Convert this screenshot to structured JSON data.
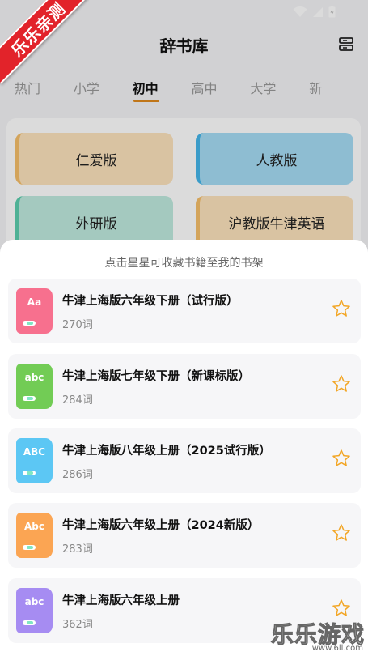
{
  "app": {
    "title": "辞书库"
  },
  "ribbon": {
    "text": "乐乐亲测"
  },
  "tabs": [
    {
      "label": "热门"
    },
    {
      "label": "小学"
    },
    {
      "label": "初中"
    },
    {
      "label": "高中"
    },
    {
      "label": "大学"
    },
    {
      "label": "新"
    }
  ],
  "active_tab": "初中",
  "editions": [
    {
      "label": "仁爱版"
    },
    {
      "label": "人教版"
    },
    {
      "label": "外研版"
    },
    {
      "label": "沪教版牛津英语"
    }
  ],
  "sheet": {
    "hint": "点击星星可收藏书籍至我的书架",
    "books": [
      {
        "cover_label": "Aa",
        "cover_color": "#f7708e",
        "title": "牛津上海版六年级下册（试行版）",
        "count": "270词"
      },
      {
        "cover_label": "abc",
        "cover_color": "#72cc55",
        "title": "牛津上海版七年级下册（新课标版）",
        "count": "284词"
      },
      {
        "cover_label": "ABC",
        "cover_color": "#5cc7f4",
        "title": "牛津上海版八年级上册（2025试行版）",
        "count": "286词"
      },
      {
        "cover_label": "Abc",
        "cover_color": "#fba553",
        "title": "牛津上海版六年级上册（2024新版）",
        "count": "283词"
      },
      {
        "cover_label": "abc",
        "cover_color": "#a68cf2",
        "title": "牛津上海版六年级上册",
        "count": "362词"
      }
    ]
  },
  "watermark": {
    "text": "乐乐游戏",
    "url": "www.6ll.com"
  },
  "colors": {
    "accent": "#e08a1e",
    "star": "#f2a626"
  }
}
